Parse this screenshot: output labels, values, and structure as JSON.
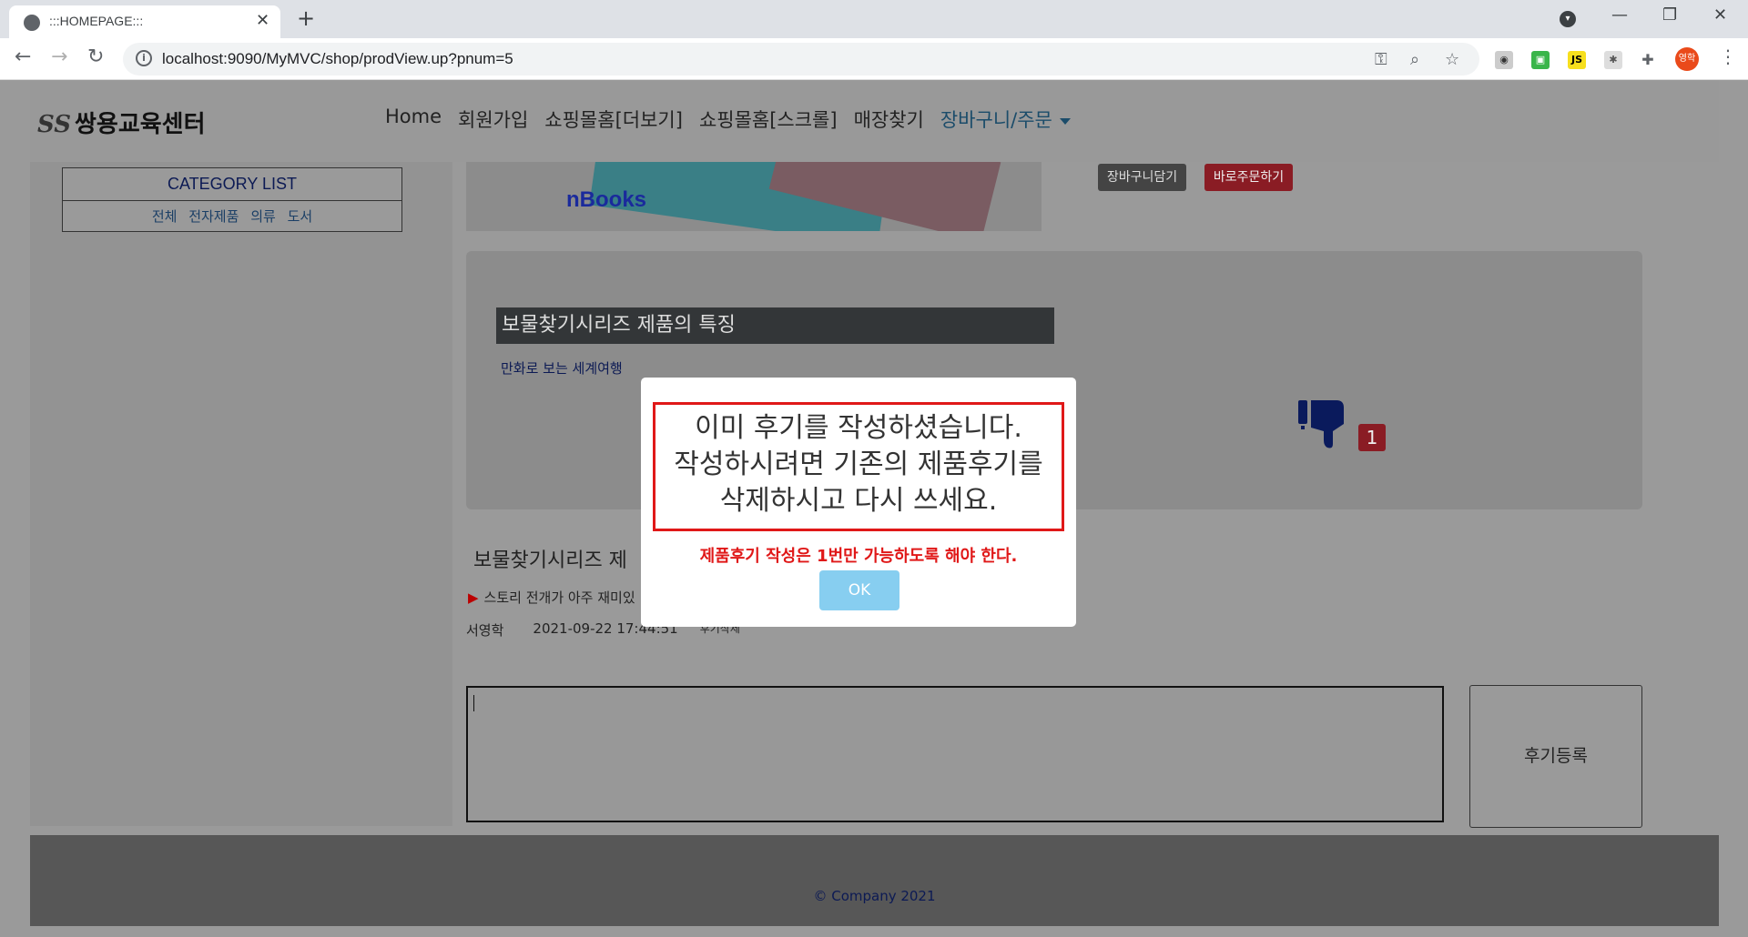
{
  "browser": {
    "tab_title": ":::HOMEPAGE:::",
    "tab_close": "✕",
    "new_tab": "+",
    "url": "localhost:9090/MyMVC/shop/prodView.up?pnum=5",
    "avatar_text": "영학",
    "window_controls": {
      "minimize": "—",
      "maximize": "❐",
      "close": "✕"
    }
  },
  "site": {
    "logo_mark": "SS",
    "logo_text": "쌍용교육센터",
    "menu": [
      "Home",
      "회원가입",
      "쇼핑몰홈[더보기]",
      "쇼핑몰홈[스크롤]",
      "매장찾기",
      "장바구니/주문"
    ]
  },
  "sidebar": {
    "title": "CATEGORY LIST",
    "links": [
      "전체",
      "전자제품",
      "의류",
      "도서"
    ]
  },
  "product": {
    "image_label": "nBooks",
    "cart_button": "장바구니담기",
    "order_button": "바로주문하기",
    "feature_title": "보물찾기시리즈 제품의 특징",
    "feature_desc": "만화로 보는 세계여행",
    "dislike_count": "1"
  },
  "reviews": {
    "heading": "보물찾기시리즈 제",
    "item_text": "스토리 전개가 아주 재미있",
    "author": "서영학",
    "date": "2021-09-22 17:44:51",
    "action": "후기삭제",
    "submit_label": "후기등록"
  },
  "footer": {
    "text": "© Company 2021"
  },
  "modal": {
    "message_lines": [
      "이미 후기를 작성하셨습니다.",
      "작성하시려면 기존의 제품후기를",
      "삭제하시고 다시 쓰세요."
    ],
    "sub_message": "제품후기 작성은 1번만 가능하도록 해야 한다.",
    "ok_label": "OK"
  }
}
